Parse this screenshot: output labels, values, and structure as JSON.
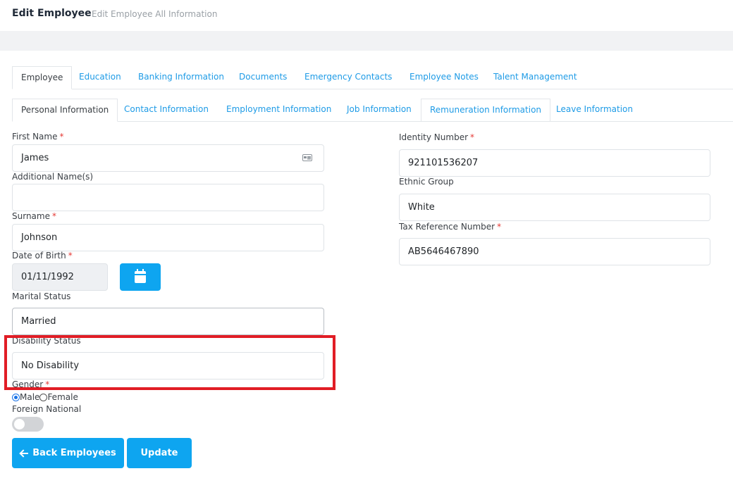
{
  "header": {
    "title": "Edit Employee",
    "subtitle": "Edit Employee All Information"
  },
  "main_tabs": [
    {
      "label": "Employee",
      "active": true
    },
    {
      "label": "Education"
    },
    {
      "label": "Banking Information"
    },
    {
      "label": "Documents"
    },
    {
      "label": "Emergency Contacts"
    },
    {
      "label": "Employee Notes"
    },
    {
      "label": "Talent Management"
    }
  ],
  "sub_tabs": [
    {
      "label": "Personal Information",
      "active": true
    },
    {
      "label": "Contact Information"
    },
    {
      "label": "Employment Information"
    },
    {
      "label": "Job Information"
    },
    {
      "label": "Remuneration Information"
    },
    {
      "label": "Leave Information"
    }
  ],
  "form": {
    "first_name": {
      "label": "First Name",
      "required": "*",
      "value": "James"
    },
    "additional_names": {
      "label": "Additional Name(s)",
      "value": ""
    },
    "surname": {
      "label": "Surname",
      "required": "*",
      "value": "Johnson"
    },
    "date_of_birth": {
      "label": "Date of Birth",
      "required": "*",
      "value": "01/11/1992"
    },
    "marital_status": {
      "label": "Marital Status",
      "value": "Married"
    },
    "disability_status": {
      "label": "Disability Status",
      "value": "No Disability"
    },
    "gender": {
      "label": "Gender",
      "required": "*",
      "options": [
        "Male",
        "Female"
      ],
      "selected": "Male"
    },
    "foreign_national": {
      "label": "Foreign National",
      "on": false
    },
    "identity_number": {
      "label": "Identity Number",
      "required": "*",
      "value": "921101536207"
    },
    "ethnic_group": {
      "label": "Ethnic Group",
      "value": "White"
    },
    "tax_reference_number": {
      "label": "Tax Reference Number",
      "required": "*",
      "value": "AB5646467890"
    }
  },
  "buttons": {
    "back": "Back Employees",
    "update": "Update"
  },
  "colors": {
    "accent": "#0ea5f0",
    "highlight": "#e11d25"
  },
  "icons": {
    "id_card": "id-card-icon",
    "calendar": "calendar-icon",
    "back_arrow": "arrow-left-icon"
  }
}
